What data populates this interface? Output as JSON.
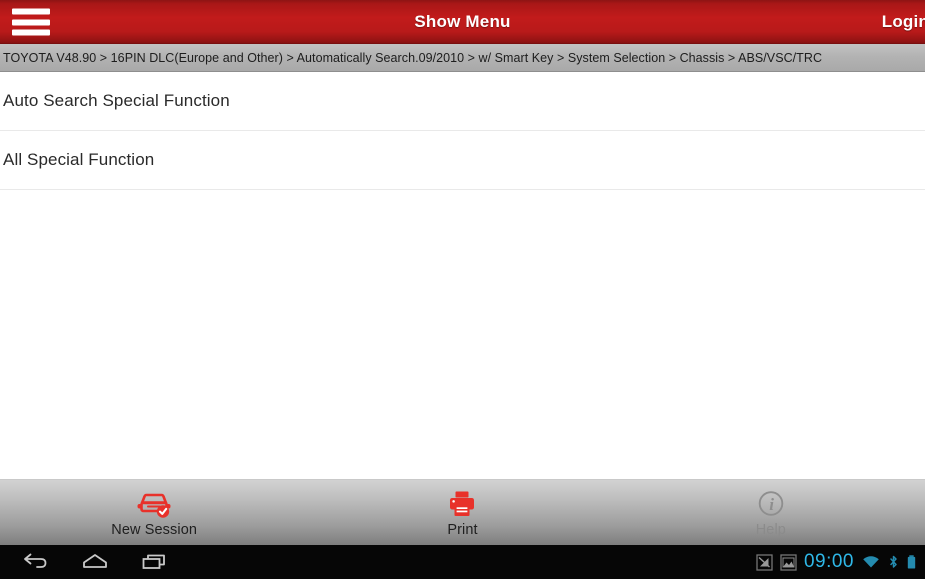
{
  "titlebar": {
    "menu_icon": "hamburger-menu-icon",
    "title": "Show Menu",
    "login_label": "Login",
    "background_color": "#c21b1b",
    "text_color": "#ffffff"
  },
  "breadcrumb": {
    "text": "TOYOTA V48.90 > 16PIN DLC(Europe and Other) > Automatically Search.09/2010 > w/ Smart Key > System Selection > Chassis > ABS/VSC/TRC",
    "background_color": "#b3b3b3",
    "text_color": "#1d1d1d"
  },
  "menu": {
    "items": [
      {
        "label": "Auto Search Special Function"
      },
      {
        "label": "All Special Function"
      }
    ]
  },
  "toolbar": {
    "buttons": [
      {
        "label": "New Session",
        "icon": "car-check-icon",
        "enabled": true,
        "icon_color": "#e8312a"
      },
      {
        "label": "Print",
        "icon": "printer-icon",
        "enabled": true,
        "icon_color": "#e8312a"
      },
      {
        "label": "Help",
        "icon": "info-circle-icon",
        "enabled": false,
        "icon_color": "#8b8b8b"
      }
    ]
  },
  "navbar": {
    "back_icon": "back-arrow-icon",
    "home_icon": "home-icon",
    "recents_icon": "recent-apps-icon",
    "notification_icons": [
      "no-sim-icon",
      "image-icon"
    ],
    "clock": "09:00",
    "clock_color": "#2fb8e8",
    "status_icons": [
      "wifi-icon",
      "bluetooth-icon",
      "battery-icon"
    ]
  }
}
